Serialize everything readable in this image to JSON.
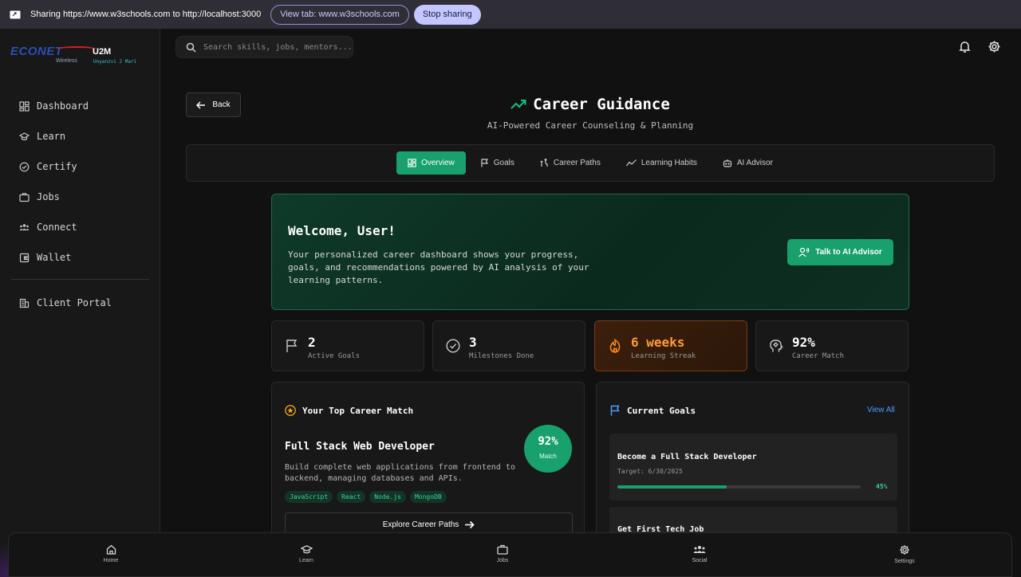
{
  "share_bar": {
    "message": "Sharing https://www.w3schools.com to http://localhost:3000",
    "view_tab": "View tab: www.w3schools.com",
    "stop": "Stop sharing"
  },
  "brand": {
    "name": "ECONET",
    "sub": "Wireless",
    "app": "U2M",
    "tagline": "Unyanzvi 2 Mari"
  },
  "sidebar": {
    "items": [
      {
        "label": "Dashboard",
        "icon": "grid-icon"
      },
      {
        "label": "Learn",
        "icon": "graduation-cap-icon"
      },
      {
        "label": "Certify",
        "icon": "check-circle-icon"
      },
      {
        "label": "Jobs",
        "icon": "briefcase-icon"
      },
      {
        "label": "Connect",
        "icon": "users-icon"
      },
      {
        "label": "Wallet",
        "icon": "wallet-icon"
      }
    ],
    "footer_item": {
      "label": "Client Portal",
      "icon": "building-icon"
    }
  },
  "search": {
    "placeholder": "Search skills, jobs, mentors..."
  },
  "page": {
    "back": "Back",
    "title": "Career Guidance",
    "subtitle": "AI-Powered Career Counseling & Planning"
  },
  "tabs": [
    {
      "label": "Overview",
      "active": true
    },
    {
      "label": "Goals",
      "active": false
    },
    {
      "label": "Career Paths",
      "active": false
    },
    {
      "label": "Learning Habits",
      "active": false
    },
    {
      "label": "AI Advisor",
      "active": false
    }
  ],
  "welcome": {
    "title": "Welcome, User!",
    "text": "Your personalized career dashboard shows your progress, goals, and recommendations powered by AI analysis of your learning patterns.",
    "button": "Talk to AI Advisor"
  },
  "stats": [
    {
      "value": "2",
      "label": "Active Goals",
      "icon": "flag-icon"
    },
    {
      "value": "3",
      "label": "Milestones Done",
      "icon": "check-circle-icon"
    },
    {
      "value": "6 weeks",
      "label": "Learning Streak",
      "icon": "flame-icon"
    },
    {
      "value": "92%",
      "label": "Career Match",
      "icon": "brain-icon"
    }
  ],
  "top_match": {
    "heading": "Your Top Career Match",
    "title": "Full Stack Web Developer",
    "description": "Build complete web applications from frontend to backend, managing databases and APIs.",
    "skills": [
      "JavaScript",
      "React",
      "Node.js",
      "MongoDB"
    ],
    "match_value": "92%",
    "match_label": "Match",
    "explore": "Explore Career Paths"
  },
  "goals": {
    "heading": "Current Goals",
    "view_all": "View All",
    "items": [
      {
        "title": "Become a Full Stack Developer",
        "target": "Target: 6/30/2025",
        "progress": 45,
        "progress_label": "45%"
      },
      {
        "title": "Get First Tech Job"
      }
    ]
  },
  "bottom_nav": [
    {
      "label": "Home",
      "icon": "home-icon"
    },
    {
      "label": "Learn",
      "icon": "graduation-cap-icon"
    },
    {
      "label": "Jobs",
      "icon": "briefcase-icon"
    },
    {
      "label": "Social",
      "icon": "users-icon"
    },
    {
      "label": "Settings",
      "icon": "gear-icon"
    }
  ],
  "colors": {
    "accent": "#18a06d",
    "streak": "#ff9a3c",
    "link": "#4f9cff"
  }
}
